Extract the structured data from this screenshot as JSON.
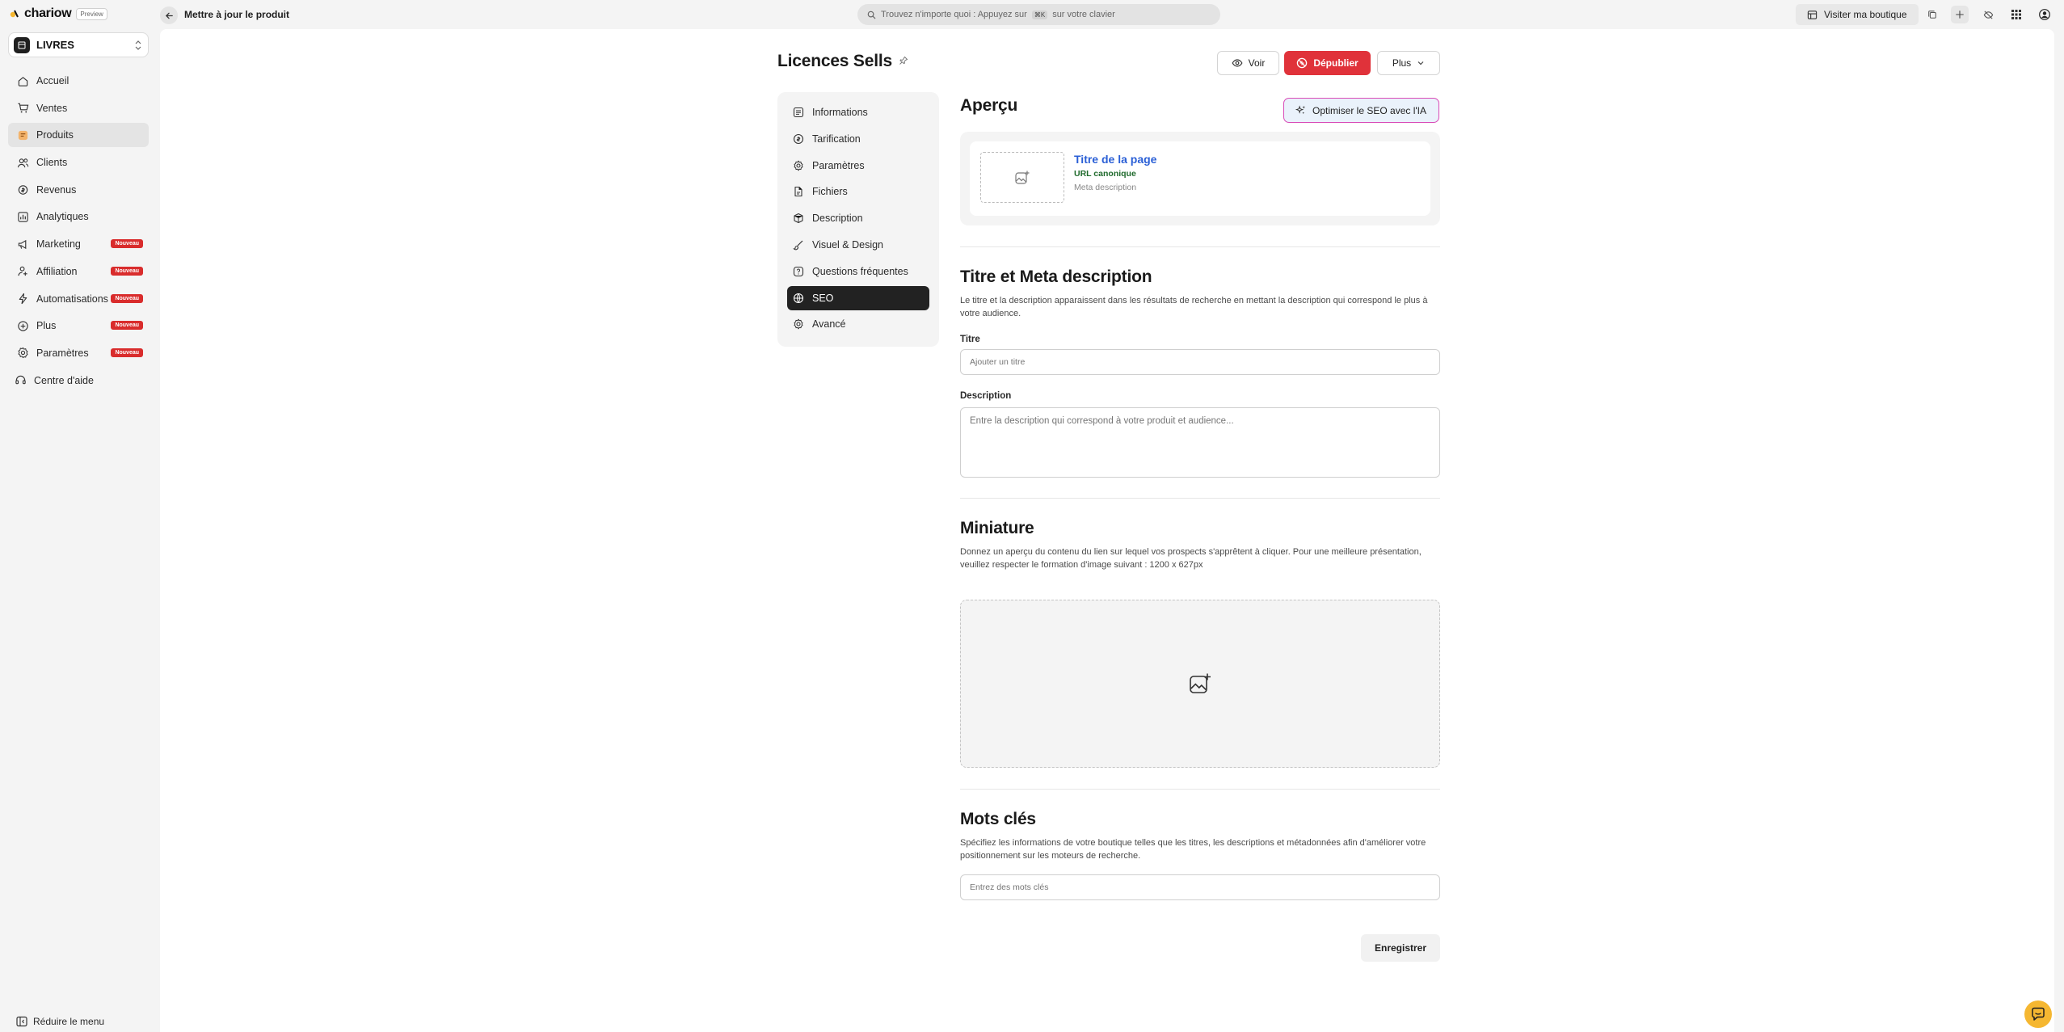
{
  "app": {
    "logo_text": "chariow",
    "preview_badge": "Preview",
    "page_title": "Mettre à jour le produit"
  },
  "search": {
    "prefix": "Trouvez n'importe quoi : Appuyez sur",
    "shortcut": "⌘K",
    "suffix": "sur votre clavier"
  },
  "topbar": {
    "visit_label": "Visiter ma boutique"
  },
  "store": {
    "name": "LIVRES"
  },
  "sidebar": {
    "items": [
      {
        "label": "Accueil",
        "icon": "home-icon",
        "badge": ""
      },
      {
        "label": "Ventes",
        "icon": "cart-icon",
        "badge": ""
      },
      {
        "label": "Produits",
        "icon": "box-icon",
        "badge": ""
      },
      {
        "label": "Clients",
        "icon": "users-icon",
        "badge": ""
      },
      {
        "label": "Revenus",
        "icon": "revenue-icon",
        "badge": ""
      },
      {
        "label": "Analytiques",
        "icon": "chart-icon",
        "badge": ""
      },
      {
        "label": "Marketing",
        "icon": "megaphone-icon",
        "badge": "Nouveau"
      },
      {
        "label": "Affiliation",
        "icon": "affiliate-icon",
        "badge": "Nouveau"
      },
      {
        "label": "Automatisations",
        "icon": "bolt-icon",
        "badge": "Nouveau"
      },
      {
        "label": "Plus",
        "icon": "plus-circle-icon",
        "badge": "Nouveau"
      },
      {
        "label": "Paramètres",
        "icon": "gear-icon",
        "badge": "Nouveau"
      },
      {
        "label": "Centre d'aide",
        "icon": "headset-icon",
        "badge": ""
      }
    ],
    "collapse_label": "Réduire le menu"
  },
  "product": {
    "title": "Licences Sells",
    "view_label": "Voir",
    "unpublish_label": "Dépublier",
    "more_label": "Plus"
  },
  "settings_nav": {
    "items": [
      {
        "label": "Informations"
      },
      {
        "label": "Tarification"
      },
      {
        "label": "Paramètres"
      },
      {
        "label": "Fichiers"
      },
      {
        "label": "Description"
      },
      {
        "label": "Visuel & Design"
      },
      {
        "label": "Questions fréquentes"
      },
      {
        "label": "SEO"
      },
      {
        "label": "Avancé"
      }
    ]
  },
  "seo": {
    "preview_heading": "Aperçu",
    "ai_button_label": "Optimiser le SEO avec l'IA",
    "preview": {
      "page_title": "Titre de la page",
      "canonical_url": "URL canonique",
      "meta_description": "Meta description"
    },
    "meta_section": {
      "heading": "Titre et Meta description",
      "description": "Le titre et la description apparaissent dans les résultats de recherche en mettant la description qui correspond le plus à votre audience.",
      "title_label": "Titre",
      "title_placeholder": "Ajouter un titre",
      "description_label": "Description",
      "description_placeholder": "Entre la description qui correspond à votre produit et audience..."
    },
    "thumbnail_section": {
      "heading": "Miniature",
      "description": "Donnez un aperçu du contenu du lien sur lequel vos prospects s'apprêtent à cliquer. Pour une meilleure présentation, veuillez respecter le formation d'image suivant : 1200 x 627px"
    },
    "keywords_section": {
      "heading": "Mots clés",
      "description": "Spécifiez les informations de votre boutique telles que les titres, les descriptions et métadonnées afin d'améliorer votre positionnement sur les moteurs de recherche.",
      "placeholder": "Entrez des mots clés"
    },
    "save_label": "Enregistrer"
  },
  "colors": {
    "accent_red": "#e0323a",
    "active_dark": "#222222",
    "link_blue": "#2a5fd6",
    "url_green": "#1f6a2c",
    "ai_border": "#d94ab7",
    "chat_yellow": "#f5b731"
  }
}
